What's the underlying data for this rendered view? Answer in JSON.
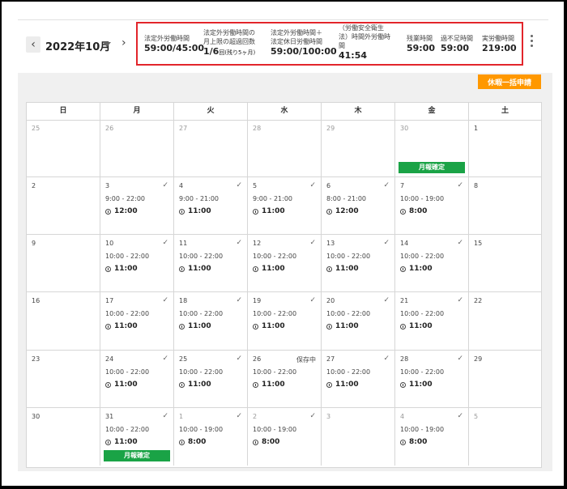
{
  "header": {
    "month": "2022年10月",
    "summary": [
      {
        "label": "法定外労働時間",
        "value": "59:00/45:00"
      },
      {
        "label": "法定外労働時間の\n月上限の超過回数",
        "value": "1/6",
        "value_suffix": "回(残り5ヶ月)"
      },
      {
        "label": "法定外労働時間＋\n法定休日労働時間",
        "value": "59:00/100:00"
      },
      {
        "label": "（労働安全衛生\n法）時間外労働時\n間",
        "value": "41:54"
      },
      {
        "label": "残業時間",
        "value": "59:00"
      },
      {
        "label": "過不足時間",
        "value": "59:00"
      },
      {
        "label": "実労働時間",
        "value": "219:00"
      }
    ]
  },
  "toolbar": {
    "bulk_leave_label": "休暇一括申請"
  },
  "calendar": {
    "weekdays": [
      "日",
      "月",
      "火",
      "水",
      "木",
      "金",
      "土"
    ],
    "weeks": [
      [
        {
          "day": "25",
          "dim": true
        },
        {
          "day": "26",
          "dim": true
        },
        {
          "day": "27",
          "dim": true
        },
        {
          "day": "28",
          "dim": true
        },
        {
          "day": "29",
          "dim": true
        },
        {
          "day": "30",
          "dim": true,
          "badge": "月報確定"
        },
        {
          "day": "1"
        }
      ],
      [
        {
          "day": "2"
        },
        {
          "day": "3",
          "check": true,
          "time": "9:00 - 22:00",
          "dur": "12:00"
        },
        {
          "day": "4",
          "check": true,
          "time": "9:00 - 21:00",
          "dur": "11:00"
        },
        {
          "day": "5",
          "check": true,
          "time": "9:00 - 21:00",
          "dur": "11:00"
        },
        {
          "day": "6",
          "check": true,
          "time": "8:00 - 21:00",
          "dur": "12:00"
        },
        {
          "day": "7",
          "check": true,
          "time": "10:00 - 19:00",
          "dur": "8:00"
        },
        {
          "day": "8"
        }
      ],
      [
        {
          "day": "9"
        },
        {
          "day": "10",
          "check": true,
          "time": "10:00 - 22:00",
          "dur": "11:00"
        },
        {
          "day": "11",
          "check": true,
          "time": "10:00 - 22:00",
          "dur": "11:00"
        },
        {
          "day": "12",
          "check": true,
          "time": "10:00 - 22:00",
          "dur": "11:00"
        },
        {
          "day": "13",
          "check": true,
          "time": "10:00 - 22:00",
          "dur": "11:00"
        },
        {
          "day": "14",
          "check": true,
          "time": "10:00 - 22:00",
          "dur": "11:00"
        },
        {
          "day": "15"
        }
      ],
      [
        {
          "day": "16"
        },
        {
          "day": "17",
          "check": true,
          "time": "10:00 - 22:00",
          "dur": "11:00"
        },
        {
          "day": "18",
          "check": true,
          "time": "10:00 - 22:00",
          "dur": "11:00"
        },
        {
          "day": "19",
          "check": true,
          "time": "10:00 - 22:00",
          "dur": "11:00"
        },
        {
          "day": "20",
          "check": true,
          "time": "10:00 - 22:00",
          "dur": "11:00"
        },
        {
          "day": "21",
          "check": true,
          "time": "10:00 - 22:00",
          "dur": "11:00"
        },
        {
          "day": "22"
        }
      ],
      [
        {
          "day": "23"
        },
        {
          "day": "24",
          "check": true,
          "time": "10:00 - 22:00",
          "dur": "11:00"
        },
        {
          "day": "25",
          "check": true,
          "time": "10:00 - 22:00",
          "dur": "11:00"
        },
        {
          "day": "26",
          "status": "保存中",
          "time": "10:00 - 22:00",
          "dur": "11:00"
        },
        {
          "day": "27",
          "check": true,
          "time": "10:00 - 22:00",
          "dur": "11:00"
        },
        {
          "day": "28",
          "check": true,
          "time": "10:00 - 22:00",
          "dur": "11:00"
        },
        {
          "day": "29"
        }
      ],
      [
        {
          "day": "30"
        },
        {
          "day": "31",
          "check": true,
          "time": "10:00 - 22:00",
          "dur": "11:00",
          "badge": "月報確定"
        },
        {
          "day": "1",
          "dim": true,
          "check": true,
          "time": "10:00 - 19:00",
          "dur": "8:00"
        },
        {
          "day": "2",
          "dim": true,
          "check": true,
          "time": "10:00 - 19:00",
          "dur": "8:00"
        },
        {
          "day": "3",
          "dim": true
        },
        {
          "day": "4",
          "dim": true,
          "check": true,
          "time": "10:00 - 19:00",
          "dur": "8:00"
        },
        {
          "day": "5",
          "dim": true
        }
      ]
    ]
  },
  "colors": {
    "accent": "#ff9800",
    "confirmed": "#1aa346",
    "highlight": "#e2252b"
  }
}
